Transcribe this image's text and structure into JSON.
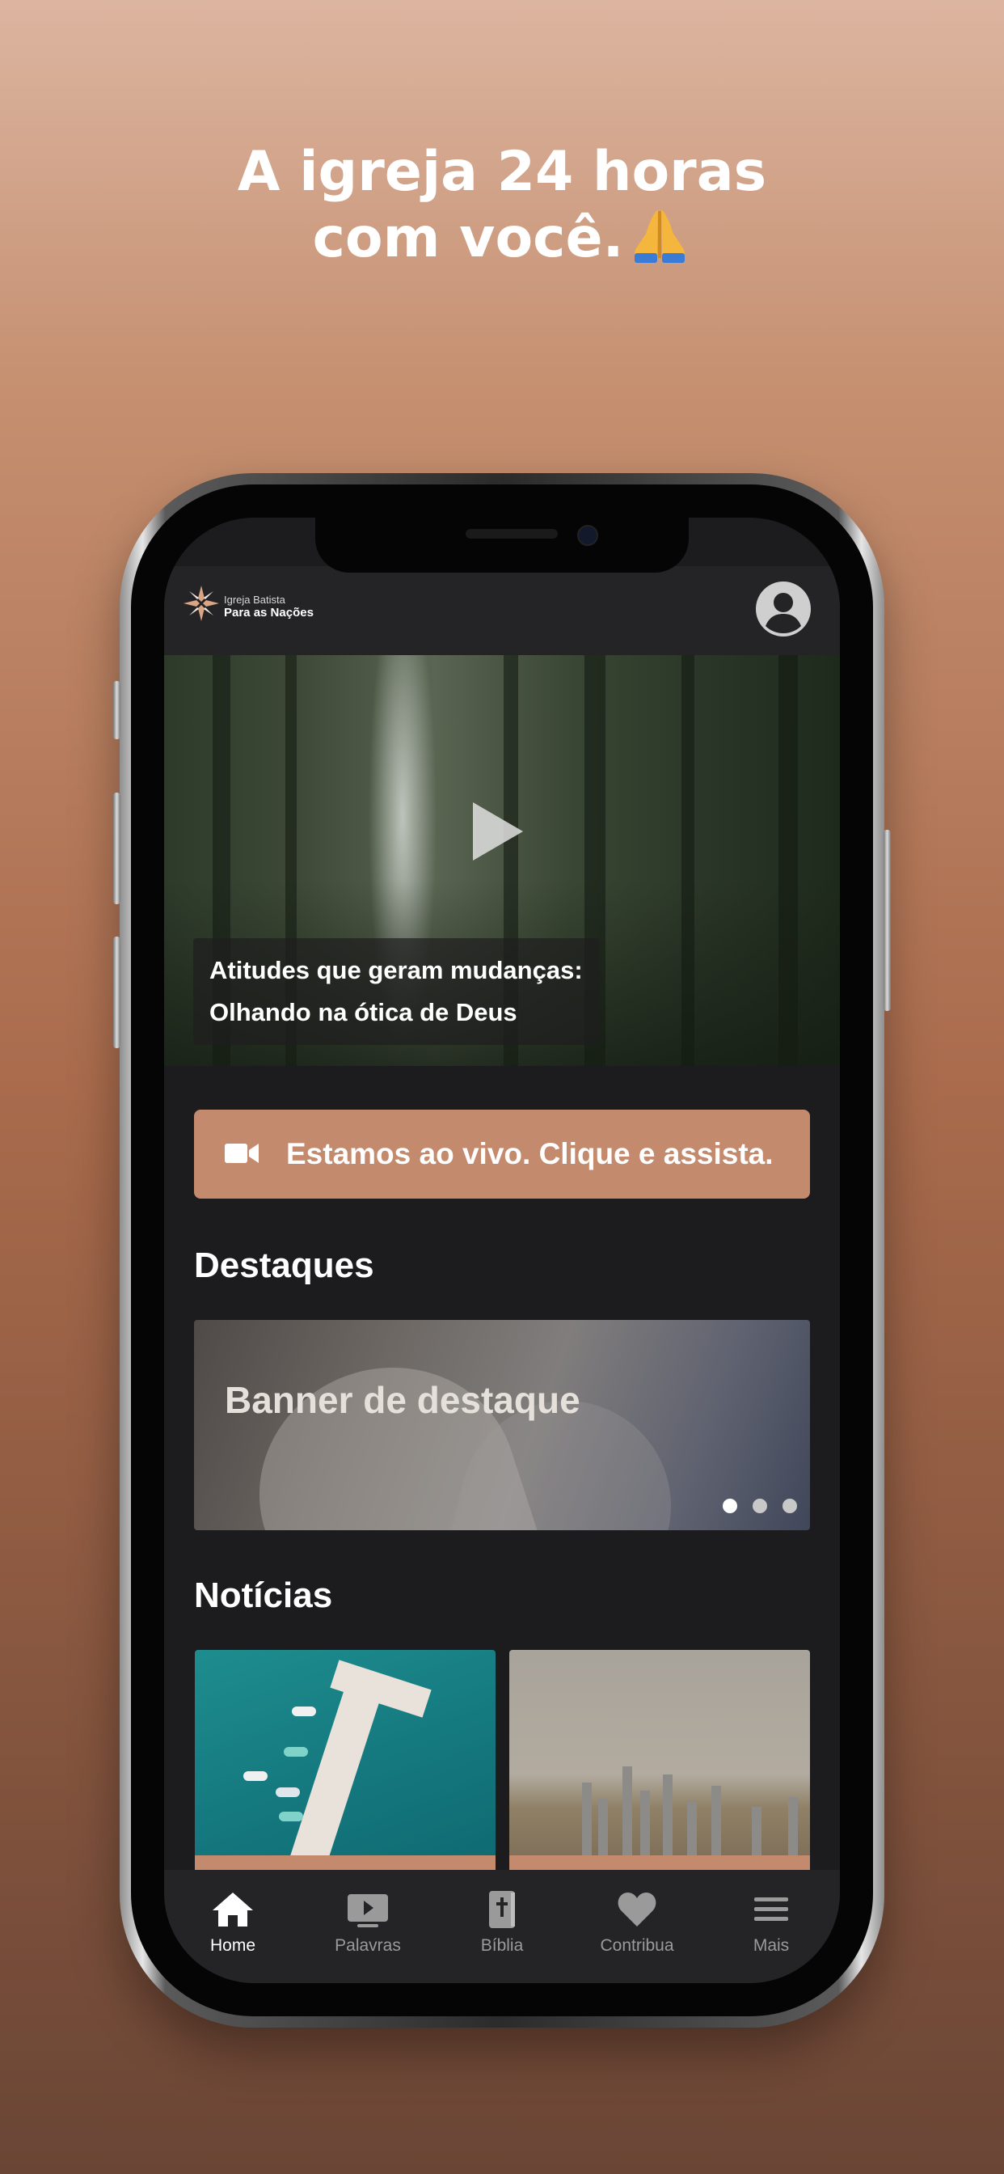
{
  "promo": {
    "headline_line1": "A igreja 24 horas",
    "headline_line2": "com você.",
    "emoji_icon": "praying-hands-icon"
  },
  "app": {
    "logo": {
      "line1": "Igreja Batista",
      "line2": "Para as Nações"
    },
    "profile_icon": "user-circle-icon",
    "hero": {
      "caption_line1": "Atitudes que geram mudanças:",
      "caption_line2": "Olhando na ótica de Deus",
      "play_icon": "play-icon"
    },
    "live": {
      "label": "Estamos ao vivo. Clique e assista.",
      "icon": "video-camera-icon"
    },
    "highlights": {
      "title": "Destaques",
      "banner_label": "Banner de destaque",
      "pages": 3,
      "active_page": 1
    },
    "news": {
      "title": "Notícias"
    },
    "tabs": [
      {
        "label": "Home",
        "icon": "home-icon",
        "active": true
      },
      {
        "label": "Palavras",
        "icon": "video-player-icon",
        "active": false
      },
      {
        "label": "Bíblia",
        "icon": "bible-icon",
        "active": false
      },
      {
        "label": "Contribua",
        "icon": "heart-icon",
        "active": false
      },
      {
        "label": "Mais",
        "icon": "menu-icon",
        "active": false
      }
    ]
  },
  "colors": {
    "accent": "#c48a6e",
    "screen_bg": "#1c1c1e",
    "bar_bg": "#242426"
  }
}
